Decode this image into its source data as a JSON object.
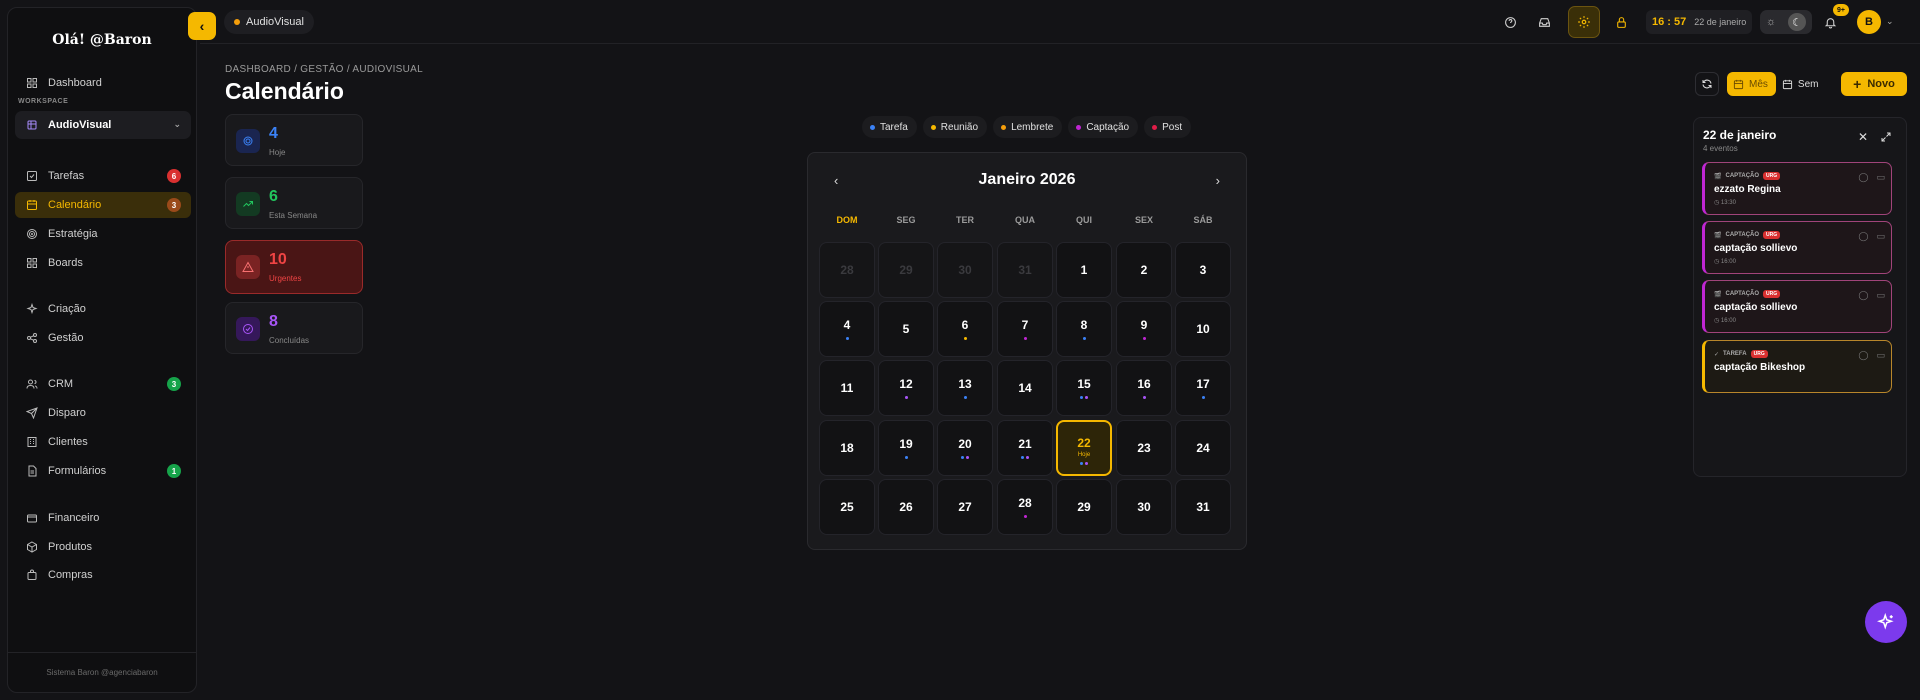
{
  "sidebar": {
    "greeting": "Olá! @Baron",
    "workspace_label": "WORKSPACE",
    "workspace": "AudioVisual",
    "items": [
      {
        "label": "Dashboard"
      },
      {
        "label": "Tarefas",
        "badge": "6"
      },
      {
        "label": "Calendário",
        "badge": "3"
      },
      {
        "label": "Estratégia"
      },
      {
        "label": "Boards"
      },
      {
        "label": "Criação"
      },
      {
        "label": "Gestão"
      },
      {
        "label": "CRM",
        "badge": "3"
      },
      {
        "label": "Disparo"
      },
      {
        "label": "Clientes"
      },
      {
        "label": "Formulários",
        "badge": "1"
      },
      {
        "label": "Financeiro"
      },
      {
        "label": "Produtos"
      },
      {
        "label": "Compras"
      }
    ],
    "footer": "Sistema Baron @agenciabaron"
  },
  "topbar": {
    "workspace_chip": "AudioVisual",
    "time": "16 : 57",
    "date": "22 de janeiro",
    "notif_count": "9+",
    "avatar": "B"
  },
  "header": {
    "breadcrumb": "DASHBOARD / GESTÃO / AUDIOVISUAL",
    "title": "Calendário",
    "view_month": "Mês",
    "view_week": "Sem",
    "new_label": "Novo"
  },
  "stats": [
    {
      "value": "4",
      "label": "Hoje"
    },
    {
      "value": "6",
      "label": "Esta Semana"
    },
    {
      "value": "10",
      "label": "Urgentes"
    },
    {
      "value": "8",
      "label": "Concluídas"
    }
  ],
  "legend": [
    {
      "label": "Tarefa",
      "color": "#3b82f6"
    },
    {
      "label": "Reunião",
      "color": "#f5b800"
    },
    {
      "label": "Lembrete",
      "color": "#f59e0b"
    },
    {
      "label": "Captação",
      "color": "#c026d3"
    },
    {
      "label": "Post",
      "color": "#e11d48"
    }
  ],
  "calendar": {
    "title": "Janeiro 2026",
    "weekdays": [
      "DOM",
      "SEG",
      "TER",
      "QUA",
      "QUI",
      "SEX",
      "SÁB"
    ],
    "today_label": "Hoje",
    "weeks": [
      [
        "28",
        "29",
        "30",
        "31",
        "1",
        "2",
        "3"
      ],
      [
        "4",
        "5",
        "6",
        "7",
        "8",
        "9",
        "10"
      ],
      [
        "11",
        "12",
        "13",
        "14",
        "15",
        "16",
        "17"
      ],
      [
        "18",
        "19",
        "20",
        "21",
        "22",
        "23",
        "24"
      ],
      [
        "25",
        "26",
        "27",
        "28",
        "29",
        "30",
        "31"
      ]
    ]
  },
  "panel": {
    "title": "22 de janeiro",
    "subtitle": "4 eventos",
    "events": [
      {
        "category": "CAPTAÇÃO",
        "urgent": "URG",
        "name": "ezzato Regina",
        "time": "13:30"
      },
      {
        "category": "CAPTAÇÃO",
        "urgent": "URG",
        "name": "captação sollievo",
        "time": "16:00"
      },
      {
        "category": "CAPTAÇÃO",
        "urgent": "URG",
        "name": "captação sollievo",
        "time": "16:00"
      },
      {
        "category": "TAREFA",
        "urgent": "URG",
        "name": "captação Bikeshop",
        "time": ""
      }
    ]
  },
  "colors": {
    "accent": "#f5b800",
    "purple": "#7c3aed",
    "danger": "#d93030",
    "success": "#16a34a"
  }
}
